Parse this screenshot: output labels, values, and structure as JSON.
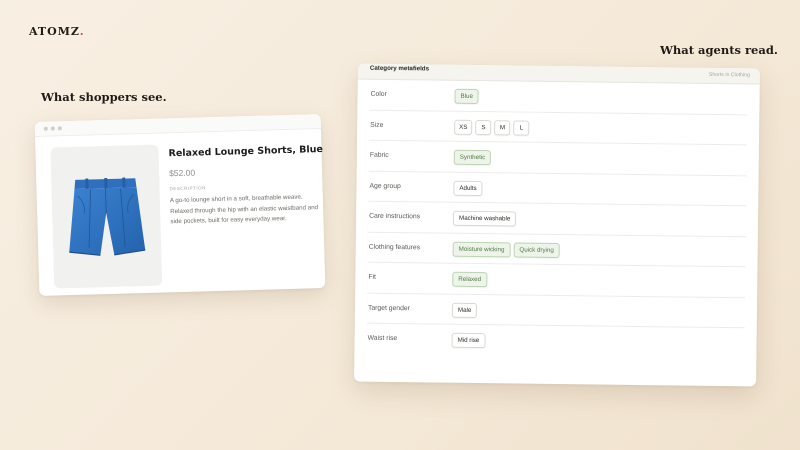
{
  "brand": {
    "logo": "ATOMZ",
    "logo_dot": "."
  },
  "captions": {
    "shoppers": "What shoppers see.",
    "agents": "What agents read."
  },
  "product": {
    "title": "Relaxed Lounge Shorts, Blue",
    "price": "$52.00",
    "description_label": "DESCRIPTION",
    "description": "A go-to lounge short in a soft, breathable weave. Relaxed through the hip with an elastic waistband and side pockets, built for easy everyday wear.",
    "image_icon": "shorts-icon",
    "image_color": "#2f73c6"
  },
  "metafields": {
    "title": "Category metafields",
    "breadcrumb": "Shorts in Clothing",
    "rows": [
      {
        "label": "Color",
        "values": [
          "Blue"
        ],
        "style": "green"
      },
      {
        "label": "Size",
        "values": [
          "XS",
          "S",
          "M",
          "L"
        ],
        "style": "plain"
      },
      {
        "label": "Fabric",
        "values": [
          "Synthetic"
        ],
        "style": "green"
      },
      {
        "label": "Age group",
        "values": [
          "Adults"
        ],
        "style": "plain"
      },
      {
        "label": "Care instructions",
        "values": [
          "Machine washable"
        ],
        "style": "plain"
      },
      {
        "label": "Clothing features",
        "values": [
          "Moisture wicking",
          "Quick drying"
        ],
        "style": "green"
      },
      {
        "label": "Fit",
        "values": [
          "Relaxed"
        ],
        "style": "green"
      },
      {
        "label": "Target gender",
        "values": [
          "Male"
        ],
        "style": "plain"
      },
      {
        "label": "Waist rise",
        "values": [
          "Mid rise"
        ],
        "style": "plain"
      }
    ]
  },
  "colors": {
    "accent_red": "#d94a3b",
    "chip_green_bg": "#eef4ea",
    "chip_green_text": "#4f7a45"
  }
}
